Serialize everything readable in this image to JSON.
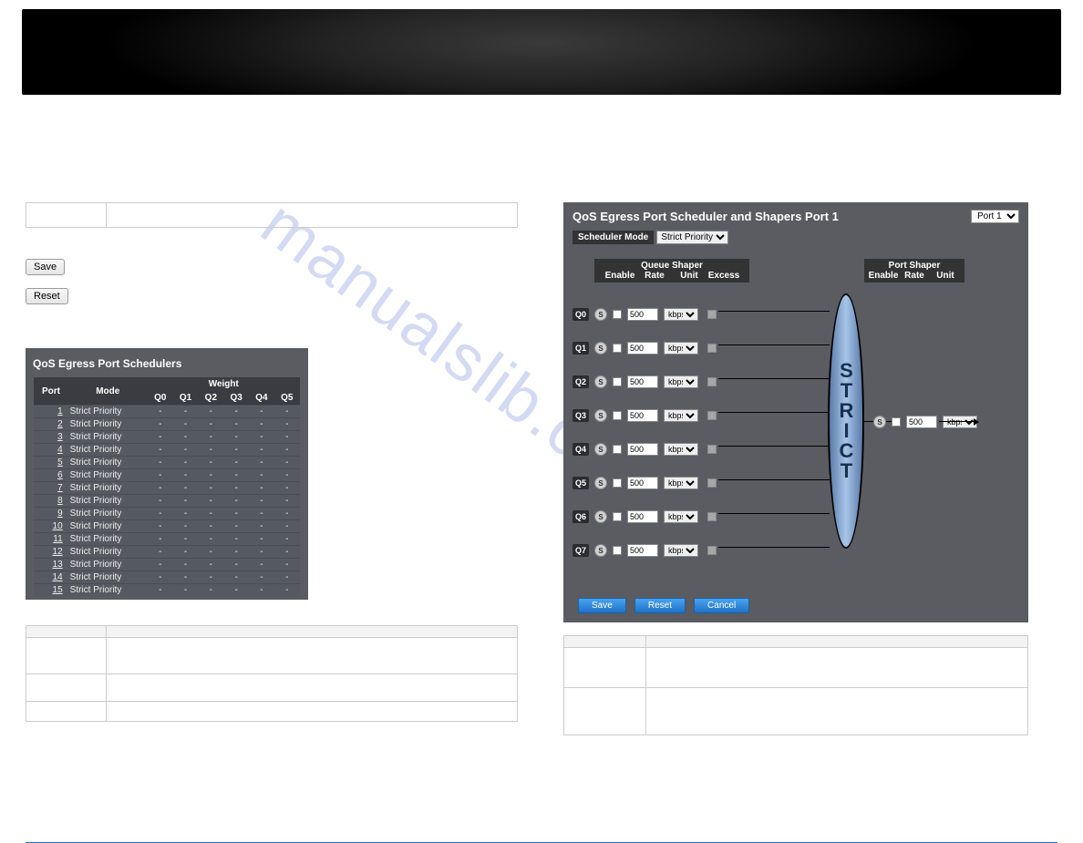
{
  "watermark": "manualslib.com",
  "left": {
    "buttons": {
      "save": "Save",
      "reset": "Reset"
    },
    "sched_panel": {
      "title": "QoS Egress Port Schedulers",
      "headers": {
        "port": "Port",
        "mode": "Mode",
        "weight": "Weight",
        "q": [
          "Q0",
          "Q1",
          "Q2",
          "Q3",
          "Q4",
          "Q5"
        ]
      },
      "rows": [
        {
          "port": "1",
          "mode": "Strict Priority",
          "w": [
            "-",
            "-",
            "-",
            "-",
            "-",
            "-"
          ]
        },
        {
          "port": "2",
          "mode": "Strict Priority",
          "w": [
            "-",
            "-",
            "-",
            "-",
            "-",
            "-"
          ]
        },
        {
          "port": "3",
          "mode": "Strict Priority",
          "w": [
            "-",
            "-",
            "-",
            "-",
            "-",
            "-"
          ]
        },
        {
          "port": "4",
          "mode": "Strict Priority",
          "w": [
            "-",
            "-",
            "-",
            "-",
            "-",
            "-"
          ]
        },
        {
          "port": "5",
          "mode": "Strict Priority",
          "w": [
            "-",
            "-",
            "-",
            "-",
            "-",
            "-"
          ]
        },
        {
          "port": "6",
          "mode": "Strict Priority",
          "w": [
            "-",
            "-",
            "-",
            "-",
            "-",
            "-"
          ]
        },
        {
          "port": "7",
          "mode": "Strict Priority",
          "w": [
            "-",
            "-",
            "-",
            "-",
            "-",
            "-"
          ]
        },
        {
          "port": "8",
          "mode": "Strict Priority",
          "w": [
            "-",
            "-",
            "-",
            "-",
            "-",
            "-"
          ]
        },
        {
          "port": "9",
          "mode": "Strict Priority",
          "w": [
            "-",
            "-",
            "-",
            "-",
            "-",
            "-"
          ]
        },
        {
          "port": "10",
          "mode": "Strict Priority",
          "w": [
            "-",
            "-",
            "-",
            "-",
            "-",
            "-"
          ]
        },
        {
          "port": "11",
          "mode": "Strict Priority",
          "w": [
            "-",
            "-",
            "-",
            "-",
            "-",
            "-"
          ]
        },
        {
          "port": "12",
          "mode": "Strict Priority",
          "w": [
            "-",
            "-",
            "-",
            "-",
            "-",
            "-"
          ]
        },
        {
          "port": "13",
          "mode": "Strict Priority",
          "w": [
            "-",
            "-",
            "-",
            "-",
            "-",
            "-"
          ]
        },
        {
          "port": "14",
          "mode": "Strict Priority",
          "w": [
            "-",
            "-",
            "-",
            "-",
            "-",
            "-"
          ]
        },
        {
          "port": "15",
          "mode": "Strict Priority",
          "w": [
            "-",
            "-",
            "-",
            "-",
            "-",
            "-"
          ]
        }
      ]
    },
    "desc": {
      "head": {
        "c1": "",
        "c2": ""
      },
      "rows": [
        {
          "k": "",
          "v": ""
        },
        {
          "k": "",
          "v": ""
        },
        {
          "k": "",
          "v": ""
        }
      ]
    }
  },
  "right": {
    "panel": {
      "title": "QoS Egress Port Scheduler and Shapers  Port 1",
      "port_select": "Port 1",
      "sched_mode_label": "Scheduler Mode",
      "sched_mode_value": "Strict Priority",
      "queue_shaper": {
        "title": "Queue Shaper",
        "cols": [
          "Enable",
          "Rate",
          "Unit",
          "Excess"
        ]
      },
      "port_shaper": {
        "title": "Port Shaper",
        "cols": [
          "Enable",
          "Rate",
          "Unit"
        ]
      },
      "queues": [
        {
          "name": "Q0",
          "rate": "500",
          "unit": "kbps"
        },
        {
          "name": "Q1",
          "rate": "500",
          "unit": "kbps"
        },
        {
          "name": "Q2",
          "rate": "500",
          "unit": "kbps"
        },
        {
          "name": "Q3",
          "rate": "500",
          "unit": "kbps"
        },
        {
          "name": "Q4",
          "rate": "500",
          "unit": "kbps"
        },
        {
          "name": "Q5",
          "rate": "500",
          "unit": "kbps"
        },
        {
          "name": "Q6",
          "rate": "500",
          "unit": "kbps"
        },
        {
          "name": "Q7",
          "rate": "500",
          "unit": "kbps"
        }
      ],
      "strict_letters": [
        "S",
        "T",
        "R",
        "I",
        "C",
        "T"
      ],
      "port_shaper_row": {
        "rate": "500",
        "unit": "kbps"
      },
      "buttons": {
        "save": "Save",
        "reset": "Reset",
        "cancel": "Cancel"
      }
    },
    "desc": {
      "head": {
        "c1": "",
        "c2": ""
      },
      "rows": [
        {
          "k": "",
          "v": ""
        },
        {
          "k": "",
          "v": ""
        }
      ]
    }
  }
}
